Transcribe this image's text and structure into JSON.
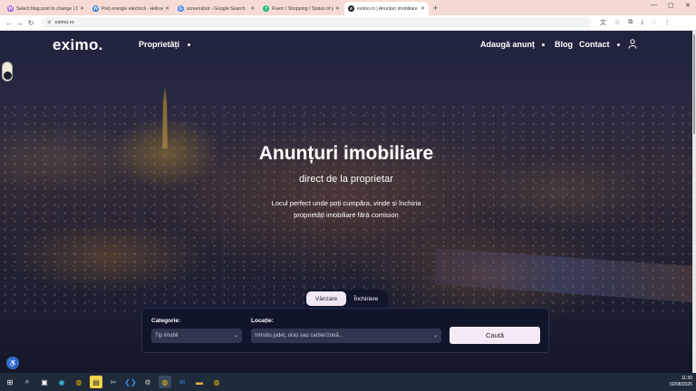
{
  "browser": {
    "tabs": [
      {
        "title": "Select blog post to change | D...",
        "favicon": "W",
        "color": "#9b5de5"
      },
      {
        "title": "Preț energie electrică - Hidroel...",
        "favicon": "W",
        "color": "#2a7bd4"
      },
      {
        "title": "screenshot - Google Search",
        "favicon": "G",
        "color": "#4285f4"
      },
      {
        "title": "Fiverr / Shopping / Status of yo...",
        "favicon": "f",
        "color": "#1dbf73"
      },
      {
        "title": "eximo.ro | Anunțuri imobiliare ...",
        "favicon": "e",
        "color": "#222"
      }
    ],
    "active_tab": 4,
    "new_tab": "+",
    "minimize": "—",
    "maximize": "▢",
    "close": "✕",
    "url": "eximo.ro",
    "back": "←",
    "forward": "→",
    "reload": "↻"
  },
  "site": {
    "logo": "eximo.",
    "nav": {
      "properties": "Proprietăți",
      "add_listing": "Adaugă anunț",
      "blog": "Blog",
      "contact": "Contact"
    },
    "hero": {
      "title": "Anunțuri imobiliare",
      "subtitle": "direct de la proprietar",
      "description": "Locul perfect unde poți cumpăra, vinde și închiria proprietăți imobiliare fără comision"
    },
    "search": {
      "tabs": [
        "Vânzare",
        "Închiriere"
      ],
      "active_tab": 0,
      "category_label": "Categorie:",
      "category_placeholder": "Tip imobil",
      "location_label": "Locație:",
      "location_placeholder": "Introdu județ, oraș sau cartier/zonă...",
      "button": "Caută"
    }
  },
  "taskbar": {
    "icons": [
      "windows-icon",
      "search-icon",
      "task-view-icon",
      "edge-icon",
      "chrome-icon",
      "sticky-notes-icon",
      "code-icon",
      "vscode-icon",
      "settings-icon",
      "chrome-profile-icon",
      "outlook-icon",
      "files-icon",
      "chrome-alt-icon"
    ],
    "time": "11:30",
    "date": "02/08/2025"
  }
}
